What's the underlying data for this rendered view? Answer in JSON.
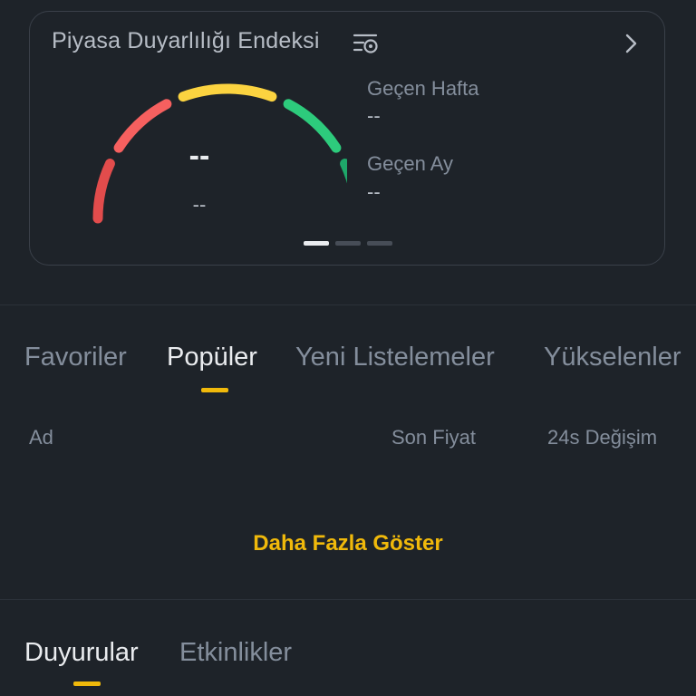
{
  "sentiment": {
    "title": "Piyasa Duyarlılığı Endeksi",
    "settings_icon": "settings-filter-icon",
    "chevron_icon": "chevron-right-icon",
    "gauge_value": "--",
    "gauge_label": "--",
    "gauge_colors": [
      "#e24c4c",
      "#f6605f",
      "#fbd340",
      "#2dcb7c",
      "#1ea86a"
    ],
    "last_week_label": "Geçen Hafta",
    "last_week_value": "--",
    "last_month_label": "Geçen Ay",
    "last_month_value": "--",
    "pagination": {
      "total": 3,
      "active": 0
    }
  },
  "market": {
    "tabs": [
      {
        "label": "Favoriler",
        "active": false
      },
      {
        "label": "Popüler",
        "active": true
      },
      {
        "label": "Yeni Listelemeler",
        "active": false
      },
      {
        "label": "Yükselenler",
        "active": false
      }
    ],
    "columns": {
      "name": "Ad",
      "price": "Son Fiyat",
      "change": "24s Değişim"
    },
    "more_label": "Daha Fazla Göster"
  },
  "bottom_tabs": [
    {
      "label": "Duyurular",
      "active": true
    },
    {
      "label": "Etkinlikler",
      "active": false
    }
  ],
  "colors": {
    "accent": "#f0b90b",
    "background": "#1e2329",
    "text_primary": "#eaecef",
    "text_secondary": "#848e9c"
  }
}
